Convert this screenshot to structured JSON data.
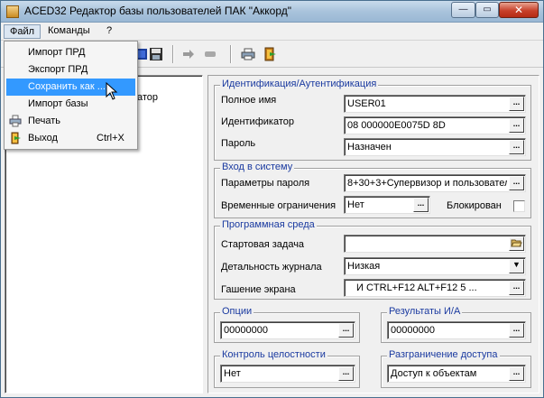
{
  "window": {
    "title": "ACED32 Редактор базы пользователей ПАК \"Аккорд\"",
    "minimize": "—",
    "maximize": "▭",
    "close": "✕"
  },
  "menubar": {
    "file": "Файл",
    "commands": "Команды",
    "help": "?"
  },
  "file_menu": {
    "items": [
      {
        "label": "Импорт ПРД",
        "shortcut": "",
        "icon": ""
      },
      {
        "label": "Экспорт ПРД",
        "shortcut": "",
        "icon": ""
      },
      {
        "label": "Сохранить как ...",
        "shortcut": "",
        "icon": ""
      },
      {
        "label": "Импорт базы",
        "shortcut": "",
        "icon": ""
      },
      {
        "label": "Печать",
        "shortcut": "",
        "icon": "printer-icon"
      },
      {
        "label": "Выход",
        "shortcut": "Ctrl+X",
        "icon": "exit-icon"
      }
    ],
    "selected_index": 2
  },
  "tree": {
    "visible_fragment": "атор"
  },
  "identification": {
    "title": "Идентификация/Аутентификация",
    "full_name_label": "Полное имя",
    "full_name_value": "USER01",
    "identifier_label": "Идентификатор",
    "identifier_value": "08 000000E0075D 8D",
    "password_label": "Пароль",
    "password_value": "Назначен"
  },
  "login": {
    "title": "Вход в систему",
    "params_label": "Параметры пароля",
    "params_value": "8+30+3+Супервизор и пользовател",
    "time_label": "Временные ограничения",
    "time_value": "Нет",
    "blocked_label": "Блокирован",
    "blocked": false
  },
  "environment": {
    "title": "Программная среда",
    "start_task_label": "Стартовая задача",
    "start_task_value": "",
    "log_detail_label": "Детальность журнала",
    "log_detail_value": "Низкая",
    "screen_off_label": "Гашение экрана",
    "screen_off_value": "И CTRL+F12 ALT+F12 5 ..."
  },
  "options": {
    "title": "Опции",
    "value": "00000000"
  },
  "ia_results": {
    "title": "Результаты И/А",
    "value": "00000000"
  },
  "integrity": {
    "title": "Контроль целостности",
    "value": "Нет"
  },
  "access": {
    "title": "Разграничение доступа",
    "value": "Доступ к объектам"
  },
  "buttons": {
    "ellipsis": "...",
    "dropdown": "▼"
  },
  "colors": {
    "group_title": "#1a3aa0",
    "selection": "#3399ff"
  }
}
